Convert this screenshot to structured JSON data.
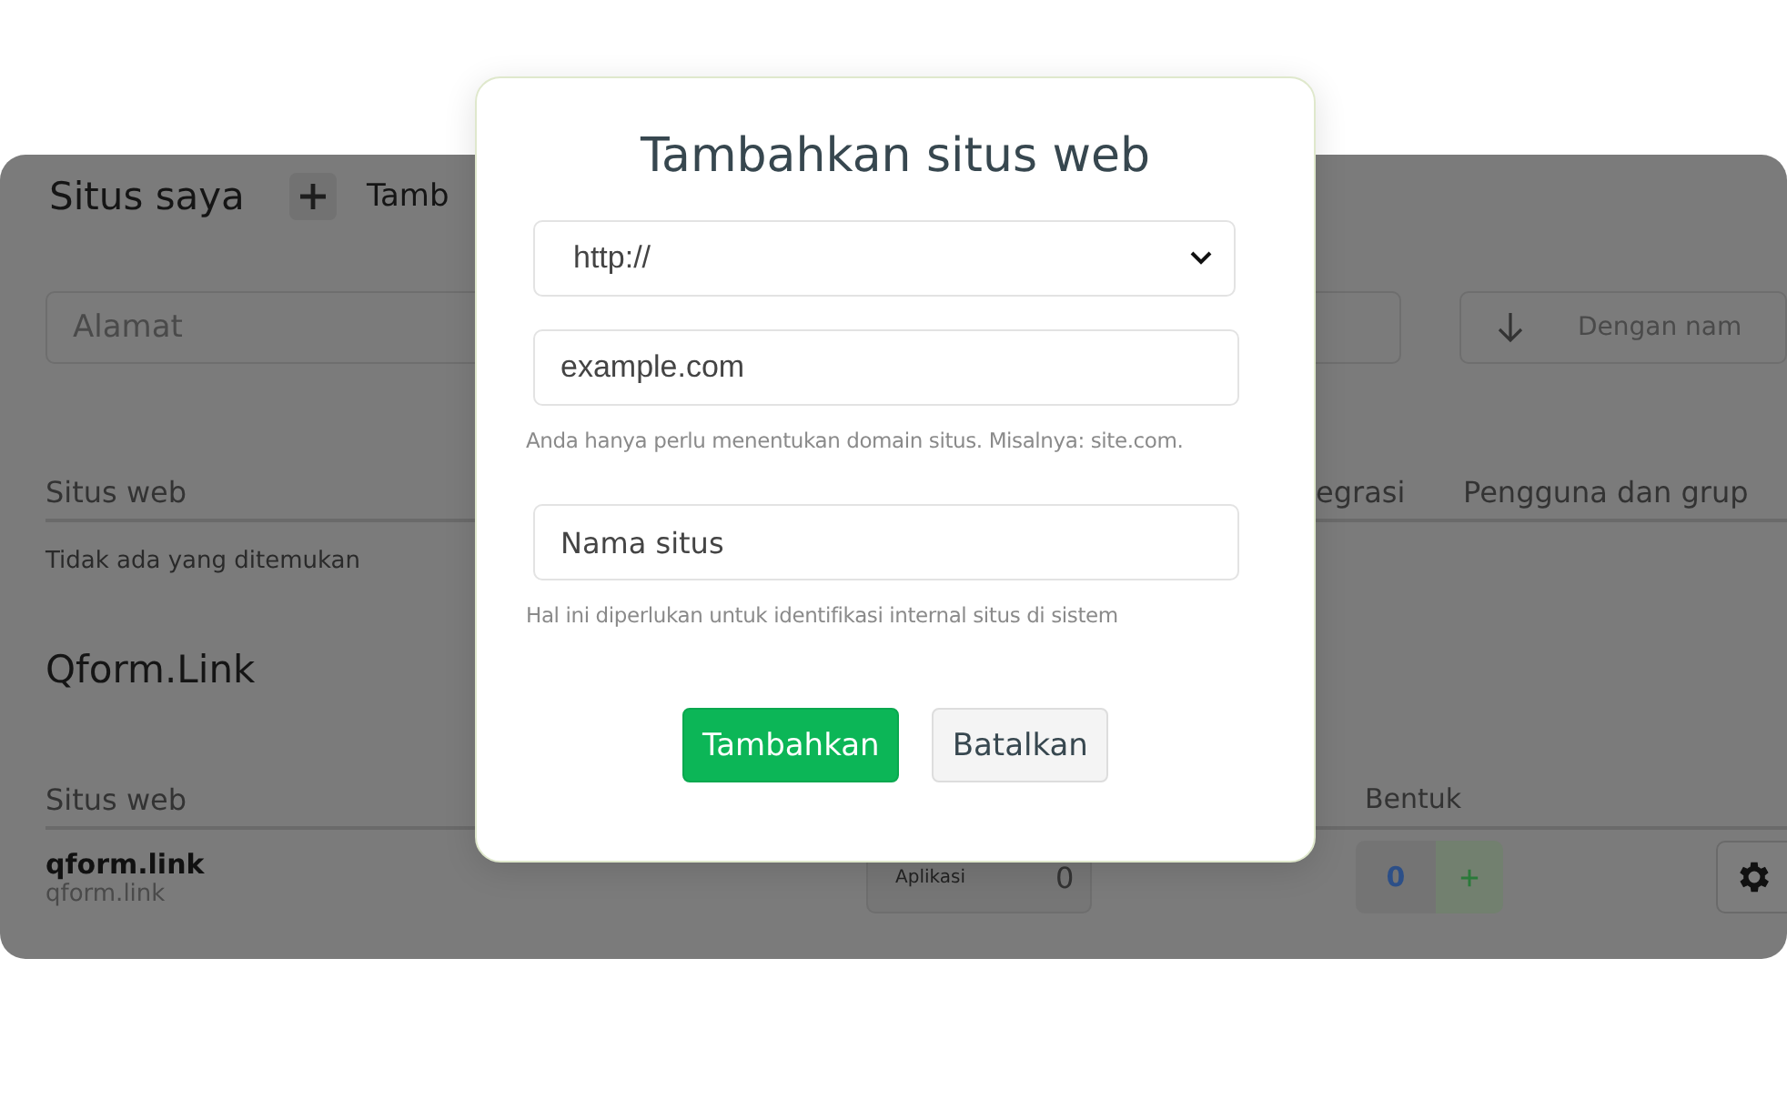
{
  "page": {
    "title": "Situs saya",
    "add_button": "Tamb",
    "filters": {
      "address": {
        "placeholder": "Alamat"
      },
      "sort": {
        "placeholder": "Dengan nam"
      }
    },
    "table": {
      "columns": [
        "Situs web",
        "egrasi",
        "Pengguna dan grup"
      ],
      "empty": "Tidak ada yang ditemukan"
    },
    "group": {
      "title": "Qform.Link",
      "columns": [
        "Situs web",
        "Bentuk"
      ],
      "rows": [
        {
          "name": "qform.link",
          "url": "qform.link",
          "apps_label": "Aplikasi",
          "apps_count": "0",
          "forms_count": "0"
        }
      ]
    }
  },
  "dialog": {
    "title": "Tambahkan situs web",
    "protocol": {
      "value": "http://"
    },
    "domain": {
      "placeholder": "example.com",
      "hint": "Anda hanya perlu menentukan domain situs. Misalnya: site.com."
    },
    "name": {
      "placeholder": "Nama situs",
      "hint": "Hal ini diperlukan untuk identifikasi internal situs di sistem"
    },
    "buttons": [
      {
        "label": "Tambahkan",
        "kind": "primary"
      },
      {
        "label": "Batalkan",
        "kind": "secondary"
      }
    ]
  }
}
